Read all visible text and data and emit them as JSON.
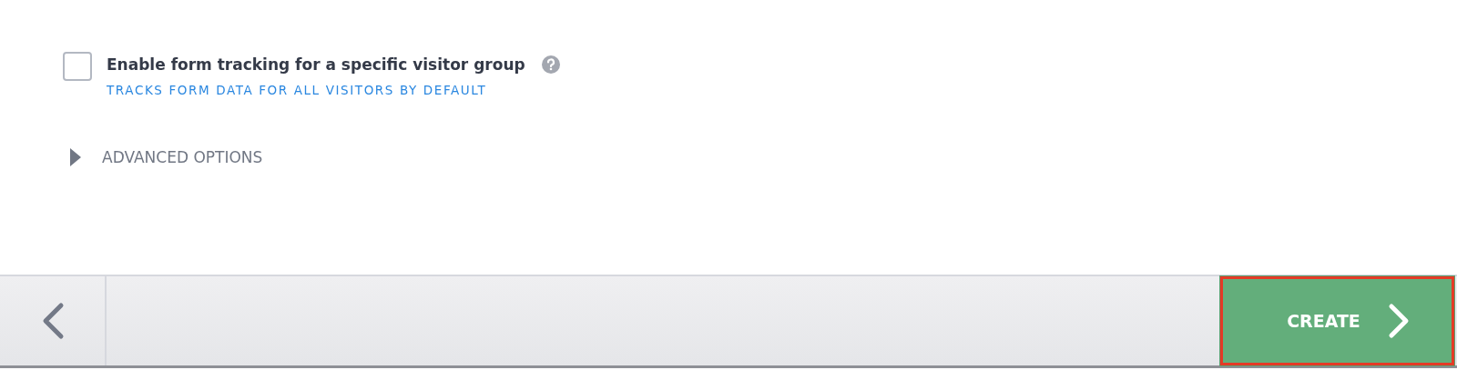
{
  "form_tracking": {
    "checked": false,
    "label": "Enable form tracking for a specific visitor group",
    "hint": "TRACKS FORM DATA FOR ALL VISITORS BY DEFAULT"
  },
  "advanced_options": {
    "label": "ADVANCED OPTIONS",
    "expanded": false
  },
  "footer": {
    "create_button": "CREATE"
  }
}
